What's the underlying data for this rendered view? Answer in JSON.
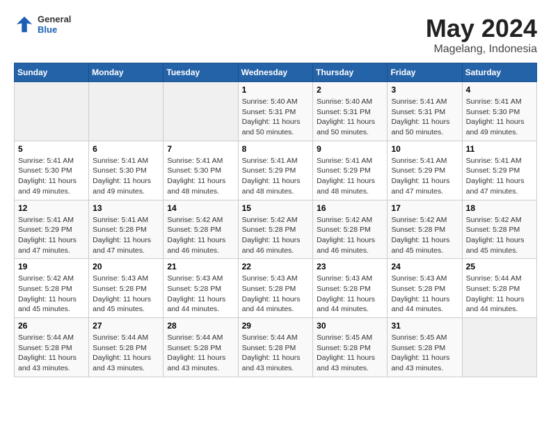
{
  "header": {
    "logo_general": "General",
    "logo_blue": "Blue",
    "month_title": "May 2024",
    "location": "Magelang, Indonesia"
  },
  "weekdays": [
    "Sunday",
    "Monday",
    "Tuesday",
    "Wednesday",
    "Thursday",
    "Friday",
    "Saturday"
  ],
  "weeks": [
    [
      {
        "day": "",
        "info": ""
      },
      {
        "day": "",
        "info": ""
      },
      {
        "day": "",
        "info": ""
      },
      {
        "day": "1",
        "info": "Sunrise: 5:40 AM\nSunset: 5:31 PM\nDaylight: 11 hours and 50 minutes."
      },
      {
        "day": "2",
        "info": "Sunrise: 5:40 AM\nSunset: 5:31 PM\nDaylight: 11 hours and 50 minutes."
      },
      {
        "day": "3",
        "info": "Sunrise: 5:41 AM\nSunset: 5:31 PM\nDaylight: 11 hours and 50 minutes."
      },
      {
        "day": "4",
        "info": "Sunrise: 5:41 AM\nSunset: 5:30 PM\nDaylight: 11 hours and 49 minutes."
      }
    ],
    [
      {
        "day": "5",
        "info": "Sunrise: 5:41 AM\nSunset: 5:30 PM\nDaylight: 11 hours and 49 minutes."
      },
      {
        "day": "6",
        "info": "Sunrise: 5:41 AM\nSunset: 5:30 PM\nDaylight: 11 hours and 49 minutes."
      },
      {
        "day": "7",
        "info": "Sunrise: 5:41 AM\nSunset: 5:30 PM\nDaylight: 11 hours and 48 minutes."
      },
      {
        "day": "8",
        "info": "Sunrise: 5:41 AM\nSunset: 5:29 PM\nDaylight: 11 hours and 48 minutes."
      },
      {
        "day": "9",
        "info": "Sunrise: 5:41 AM\nSunset: 5:29 PM\nDaylight: 11 hours and 48 minutes."
      },
      {
        "day": "10",
        "info": "Sunrise: 5:41 AM\nSunset: 5:29 PM\nDaylight: 11 hours and 47 minutes."
      },
      {
        "day": "11",
        "info": "Sunrise: 5:41 AM\nSunset: 5:29 PM\nDaylight: 11 hours and 47 minutes."
      }
    ],
    [
      {
        "day": "12",
        "info": "Sunrise: 5:41 AM\nSunset: 5:29 PM\nDaylight: 11 hours and 47 minutes."
      },
      {
        "day": "13",
        "info": "Sunrise: 5:41 AM\nSunset: 5:28 PM\nDaylight: 11 hours and 47 minutes."
      },
      {
        "day": "14",
        "info": "Sunrise: 5:42 AM\nSunset: 5:28 PM\nDaylight: 11 hours and 46 minutes."
      },
      {
        "day": "15",
        "info": "Sunrise: 5:42 AM\nSunset: 5:28 PM\nDaylight: 11 hours and 46 minutes."
      },
      {
        "day": "16",
        "info": "Sunrise: 5:42 AM\nSunset: 5:28 PM\nDaylight: 11 hours and 46 minutes."
      },
      {
        "day": "17",
        "info": "Sunrise: 5:42 AM\nSunset: 5:28 PM\nDaylight: 11 hours and 45 minutes."
      },
      {
        "day": "18",
        "info": "Sunrise: 5:42 AM\nSunset: 5:28 PM\nDaylight: 11 hours and 45 minutes."
      }
    ],
    [
      {
        "day": "19",
        "info": "Sunrise: 5:42 AM\nSunset: 5:28 PM\nDaylight: 11 hours and 45 minutes."
      },
      {
        "day": "20",
        "info": "Sunrise: 5:43 AM\nSunset: 5:28 PM\nDaylight: 11 hours and 45 minutes."
      },
      {
        "day": "21",
        "info": "Sunrise: 5:43 AM\nSunset: 5:28 PM\nDaylight: 11 hours and 44 minutes."
      },
      {
        "day": "22",
        "info": "Sunrise: 5:43 AM\nSunset: 5:28 PM\nDaylight: 11 hours and 44 minutes."
      },
      {
        "day": "23",
        "info": "Sunrise: 5:43 AM\nSunset: 5:28 PM\nDaylight: 11 hours and 44 minutes."
      },
      {
        "day": "24",
        "info": "Sunrise: 5:43 AM\nSunset: 5:28 PM\nDaylight: 11 hours and 44 minutes."
      },
      {
        "day": "25",
        "info": "Sunrise: 5:44 AM\nSunset: 5:28 PM\nDaylight: 11 hours and 44 minutes."
      }
    ],
    [
      {
        "day": "26",
        "info": "Sunrise: 5:44 AM\nSunset: 5:28 PM\nDaylight: 11 hours and 43 minutes."
      },
      {
        "day": "27",
        "info": "Sunrise: 5:44 AM\nSunset: 5:28 PM\nDaylight: 11 hours and 43 minutes."
      },
      {
        "day": "28",
        "info": "Sunrise: 5:44 AM\nSunset: 5:28 PM\nDaylight: 11 hours and 43 minutes."
      },
      {
        "day": "29",
        "info": "Sunrise: 5:44 AM\nSunset: 5:28 PM\nDaylight: 11 hours and 43 minutes."
      },
      {
        "day": "30",
        "info": "Sunrise: 5:45 AM\nSunset: 5:28 PM\nDaylight: 11 hours and 43 minutes."
      },
      {
        "day": "31",
        "info": "Sunrise: 5:45 AM\nSunset: 5:28 PM\nDaylight: 11 hours and 43 minutes."
      },
      {
        "day": "",
        "info": ""
      }
    ]
  ]
}
